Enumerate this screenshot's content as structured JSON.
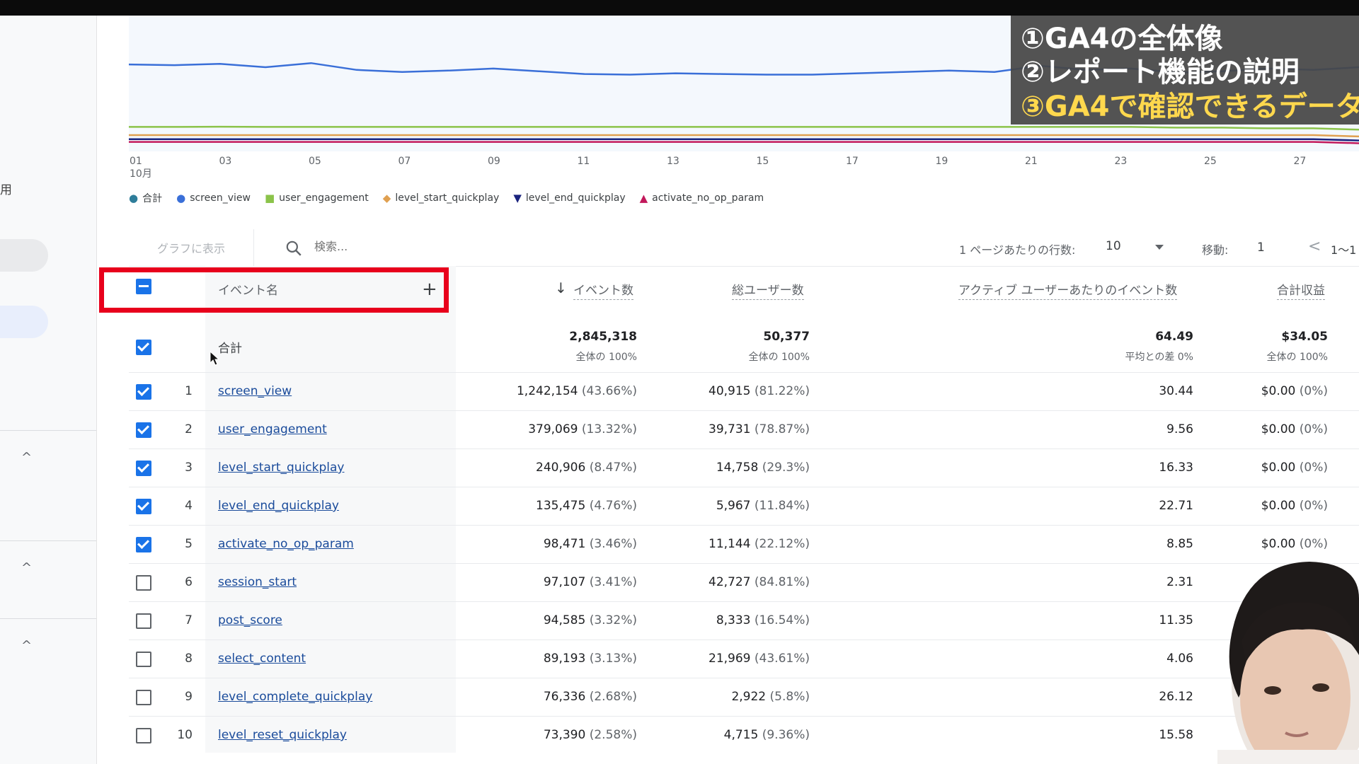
{
  "sidebar": {
    "text_fragment": "用",
    "chevrons": [
      "^",
      "^",
      "^"
    ]
  },
  "chart": {
    "x_ticks": [
      "01",
      "03",
      "05",
      "07",
      "09",
      "11",
      "13",
      "15",
      "17",
      "19",
      "21",
      "23",
      "25",
      "27"
    ],
    "month_label": "10月",
    "legend": [
      {
        "label": "合計",
        "color": "#2e7d9a",
        "marker": "pin"
      },
      {
        "label": "screen_view",
        "color": "#3a6fd8",
        "marker": "circle"
      },
      {
        "label": "user_engagement",
        "color": "#8bc34a",
        "marker": "square"
      },
      {
        "label": "level_start_quickplay",
        "color": "#e0a050",
        "marker": "diamond"
      },
      {
        "label": "level_end_quickplay",
        "color": "#1a237e",
        "marker": "triangle-down"
      },
      {
        "label": "activate_no_op_param",
        "color": "#c2185b",
        "marker": "triangle-up"
      }
    ]
  },
  "chart_data": {
    "type": "line",
    "x": [
      "01",
      "02",
      "03",
      "04",
      "05",
      "06",
      "07",
      "08",
      "09",
      "10",
      "11",
      "12",
      "13",
      "14",
      "15",
      "16",
      "17",
      "18",
      "19",
      "20",
      "21",
      "22",
      "23",
      "24",
      "25",
      "26",
      "27",
      "28"
    ],
    "series": [
      {
        "name": "合計",
        "values": [
          64,
          63.5,
          64.5,
          62,
          65,
          60,
          58.5,
          59.5,
          61,
          59,
          57,
          56.5,
          57.5,
          57,
          56.5,
          56.5,
          57.5,
          58.5,
          59.5,
          58.5,
          63,
          60,
          61,
          58,
          59,
          61,
          60,
          62
        ]
      },
      {
        "name": "user_engagement",
        "values": [
          18,
          18,
          18.2,
          18,
          18,
          18,
          18,
          18,
          18,
          18,
          18,
          18,
          18,
          18,
          18,
          18,
          18,
          18,
          18,
          18,
          18,
          18,
          18,
          17.5,
          17.5,
          17,
          17,
          16
        ]
      },
      {
        "name": "level_start_quickplay",
        "values": [
          12,
          12,
          12,
          12,
          12,
          12,
          12,
          12,
          12,
          12,
          12,
          12,
          12,
          12,
          12,
          12,
          12,
          12,
          12,
          12,
          12,
          12,
          12,
          12,
          12,
          12,
          12,
          11
        ]
      },
      {
        "name": "level_end_quickplay",
        "values": [
          9,
          9,
          9,
          9,
          9,
          9,
          9,
          9,
          9,
          9,
          9,
          9,
          9,
          9,
          9,
          9,
          9,
          9,
          9,
          9,
          9,
          9,
          9,
          9,
          9,
          9,
          9,
          8
        ]
      },
      {
        "name": "activate_no_op_param",
        "values": [
          7,
          7,
          7,
          7,
          7,
          7,
          7,
          7,
          7,
          7,
          7,
          7,
          7,
          7,
          7,
          7,
          7,
          7,
          7,
          7,
          7,
          7,
          7,
          7,
          7,
          7,
          7,
          6
        ]
      }
    ],
    "series_colors": [
      "#3a6fd8",
      "#8bc34a",
      "#e0a050",
      "#1a237e",
      "#c2185b"
    ],
    "ylim": [
      0,
      100
    ],
    "legend_position": "bottom-left",
    "grid": false
  },
  "overlay": {
    "line1": "①GA4の全体像",
    "line2": "②レポート機能の説明",
    "line3": "③GA4で確認できるデータ"
  },
  "toolbar": {
    "graph_button": "グラフに表示",
    "search_placeholder": "検索...",
    "rows_label": "1 ページあたりの行数:",
    "rows_value": "10",
    "move_label": "移動:",
    "move_value": "1",
    "range_text": "1〜1"
  },
  "table": {
    "headers": {
      "event_name": "イベント名",
      "plus": "+",
      "sort_arrow": "↓",
      "event_count": "イベント数",
      "total_users": "総ユーザー数",
      "per_user": "アクティブ ユーザーあたりのイベント数",
      "revenue": "合計収益"
    },
    "total": {
      "label": "合計",
      "event_count": "2,845,318",
      "event_count_sub": "全体の 100%",
      "total_users": "50,377",
      "total_users_sub": "全体の 100%",
      "per_user": "64.49",
      "per_user_sub": "平均との差 0%",
      "revenue": "$34.05",
      "revenue_sub": "全体の 100%"
    },
    "rows": [
      {
        "num": "1",
        "name": "screen_view",
        "count": "1,242,154",
        "count_pct": "(43.66%)",
        "users": "40,915",
        "users_pct": "(81.22%)",
        "per_user": "30.44",
        "revenue": "$0.00",
        "revenue_pct": "(0%)",
        "checked": true
      },
      {
        "num": "2",
        "name": "user_engagement",
        "count": "379,069",
        "count_pct": "(13.32%)",
        "users": "39,731",
        "users_pct": "(78.87%)",
        "per_user": "9.56",
        "revenue": "$0.00",
        "revenue_pct": "(0%)",
        "checked": true
      },
      {
        "num": "3",
        "name": "level_start_quickplay",
        "count": "240,906",
        "count_pct": "(8.47%)",
        "users": "14,758",
        "users_pct": "(29.3%)",
        "per_user": "16.33",
        "revenue": "$0.00",
        "revenue_pct": "(0%)",
        "checked": true
      },
      {
        "num": "4",
        "name": "level_end_quickplay",
        "count": "135,475",
        "count_pct": "(4.76%)",
        "users": "5,967",
        "users_pct": "(11.84%)",
        "per_user": "22.71",
        "revenue": "$0.00",
        "revenue_pct": "(0%)",
        "checked": true
      },
      {
        "num": "5",
        "name": "activate_no_op_param",
        "count": "98,471",
        "count_pct": "(3.46%)",
        "users": "11,144",
        "users_pct": "(22.12%)",
        "per_user": "8.85",
        "revenue": "$0.00",
        "revenue_pct": "(0%)",
        "checked": true
      },
      {
        "num": "6",
        "name": "session_start",
        "count": "97,107",
        "count_pct": "(3.41%)",
        "users": "42,727",
        "users_pct": "(84.81%)",
        "per_user": "2.31",
        "revenue": "",
        "revenue_pct": "",
        "checked": false
      },
      {
        "num": "7",
        "name": "post_score",
        "count": "94,585",
        "count_pct": "(3.32%)",
        "users": "8,333",
        "users_pct": "(16.54%)",
        "per_user": "11.35",
        "revenue": "",
        "revenue_pct": "",
        "checked": false
      },
      {
        "num": "8",
        "name": "select_content",
        "count": "89,193",
        "count_pct": "(3.13%)",
        "users": "21,969",
        "users_pct": "(43.61%)",
        "per_user": "4.06",
        "revenue": "",
        "revenue_pct": "",
        "checked": false
      },
      {
        "num": "9",
        "name": "level_complete_quickplay",
        "count": "76,336",
        "count_pct": "(2.68%)",
        "users": "2,922",
        "users_pct": "(5.8%)",
        "per_user": "26.12",
        "revenue": "",
        "revenue_pct": "",
        "checked": false
      },
      {
        "num": "10",
        "name": "level_reset_quickplay",
        "count": "73,390",
        "count_pct": "(2.58%)",
        "users": "4,715",
        "users_pct": "(9.36%)",
        "per_user": "15.58",
        "revenue": "",
        "revenue_pct": "",
        "checked": false
      }
    ]
  },
  "colors": {
    "accent": "#1a73e8",
    "highlight_box": "#e8001c",
    "link": "#1a4b9b"
  }
}
